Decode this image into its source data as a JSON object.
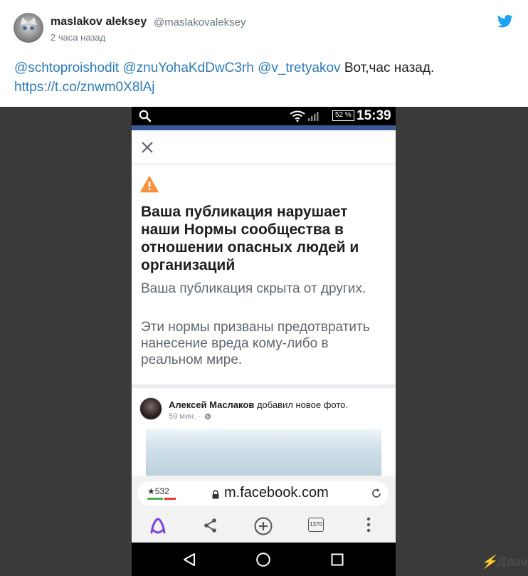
{
  "tweet": {
    "user_name": "maslakov aleksey",
    "user_handle": "@maslakovaleksey",
    "timestamp": "2 часа назад",
    "mentions": [
      "@schtoproishodit",
      "@znuYohaKdDwC3rh",
      "@v_tretyakov"
    ],
    "text": "Вот,час назад.",
    "link": "https://t.co/znwm0X8lAj",
    "accent_color": "#2b7bb9",
    "brand_icon": "twitter-bird-icon"
  },
  "phone": {
    "statusbar": {
      "battery": "52 %",
      "time": "15:39"
    },
    "notice": {
      "title": "Ваша публикация нарушает наши Нормы сообщества в отношении опасных людей и организаций",
      "subtitle": "Ваша публикация скрыта от других.",
      "description": "Эти нормы призваны предотвратить нанесение вреда кому-либо в реальном мире."
    },
    "post": {
      "author": "Алексей Маслаков",
      "action": "добавил новое фото.",
      "meta": "59 мин. ·"
    },
    "browser": {
      "rating": "★532",
      "url": "m.facebook.com",
      "tabs_count": "1370"
    }
  },
  "watermark": "Двач"
}
